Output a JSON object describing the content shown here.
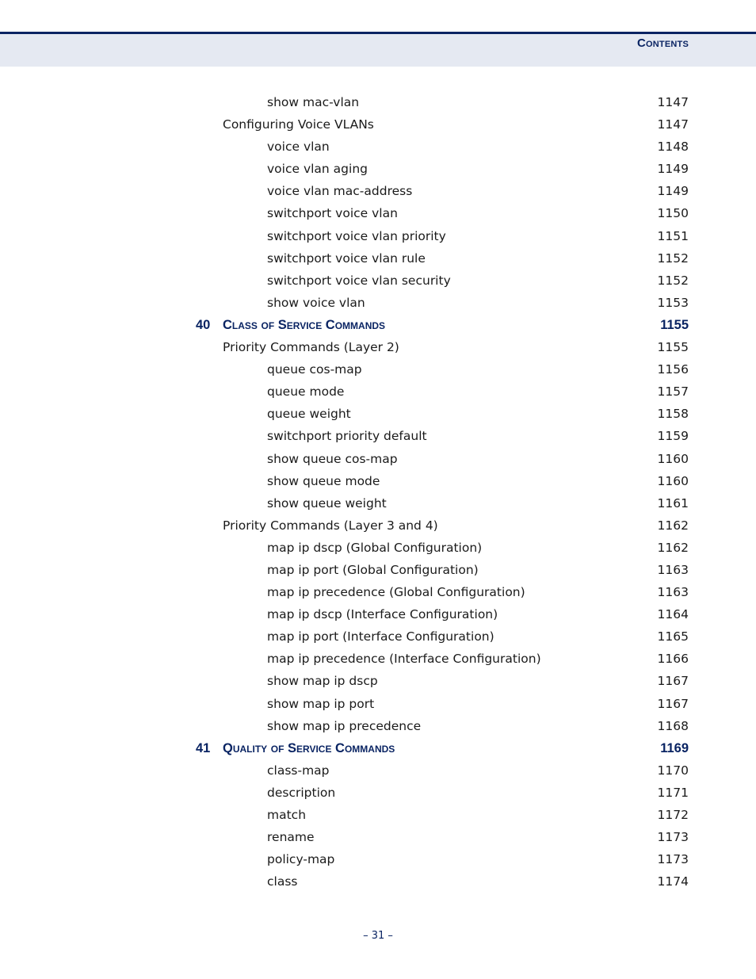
{
  "header": {
    "title": "Contents"
  },
  "toc": [
    {
      "level": 3,
      "label": "show mac-vlan",
      "page": "1147"
    },
    {
      "level": 2,
      "label": "Configuring Voice VLANs",
      "page": "1147"
    },
    {
      "level": 3,
      "label": "voice vlan",
      "page": "1148"
    },
    {
      "level": 3,
      "label": "voice vlan aging",
      "page": "1149"
    },
    {
      "level": 3,
      "label": "voice vlan mac-address",
      "page": "1149"
    },
    {
      "level": 3,
      "label": "switchport voice vlan",
      "page": "1150"
    },
    {
      "level": 3,
      "label": "switchport voice vlan priority",
      "page": "1151"
    },
    {
      "level": 3,
      "label": "switchport voice vlan rule",
      "page": "1152"
    },
    {
      "level": 3,
      "label": "switchport voice vlan security",
      "page": "1152"
    },
    {
      "level": 3,
      "label": "show voice vlan",
      "page": "1153"
    },
    {
      "level": 1,
      "num": "40",
      "label": "Class of Service Commands",
      "page": "1155"
    },
    {
      "level": 2,
      "label": "Priority Commands (Layer 2)",
      "page": "1155"
    },
    {
      "level": 3,
      "label": "queue cos-map",
      "page": "1156"
    },
    {
      "level": 3,
      "label": "queue mode",
      "page": "1157"
    },
    {
      "level": 3,
      "label": "queue weight",
      "page": "1158"
    },
    {
      "level": 3,
      "label": "switchport priority default",
      "page": "1159"
    },
    {
      "level": 3,
      "label": "show queue cos-map",
      "page": "1160"
    },
    {
      "level": 3,
      "label": "show queue mode",
      "page": "1160"
    },
    {
      "level": 3,
      "label": "show queue weight",
      "page": "1161"
    },
    {
      "level": 2,
      "label": "Priority Commands (Layer 3 and 4)",
      "page": "1162"
    },
    {
      "level": 3,
      "label": "map ip dscp (Global Configuration)",
      "page": "1162"
    },
    {
      "level": 3,
      "label": "map ip port (Global Configuration)",
      "page": "1163"
    },
    {
      "level": 3,
      "label": "map ip precedence (Global Configuration)",
      "page": "1163"
    },
    {
      "level": 3,
      "label": "map ip dscp (Interface Configuration)",
      "page": "1164"
    },
    {
      "level": 3,
      "label": "map ip port (Interface Configuration)",
      "page": "1165"
    },
    {
      "level": 3,
      "label": "map ip precedence (Interface Configuration)",
      "page": "1166"
    },
    {
      "level": 3,
      "label": "show map ip dscp",
      "page": "1167"
    },
    {
      "level": 3,
      "label": "show map ip port",
      "page": "1167"
    },
    {
      "level": 3,
      "label": "show map ip precedence",
      "page": "1168"
    },
    {
      "level": 1,
      "num": "41",
      "label": "Quality of Service Commands",
      "page": "1169"
    },
    {
      "level": 3,
      "label": "class-map",
      "page": "1170"
    },
    {
      "level": 3,
      "label": "description",
      "page": "1171"
    },
    {
      "level": 3,
      "label": "match",
      "page": "1172"
    },
    {
      "level": 3,
      "label": "rename",
      "page": "1173"
    },
    {
      "level": 3,
      "label": "policy-map",
      "page": "1173"
    },
    {
      "level": 3,
      "label": "class",
      "page": "1174"
    }
  ],
  "footer": {
    "page_number": "–  31  –"
  },
  "colors": {
    "accent": "#0a2463",
    "header_band": "#e5e9f2",
    "text": "#1a1a1a"
  }
}
